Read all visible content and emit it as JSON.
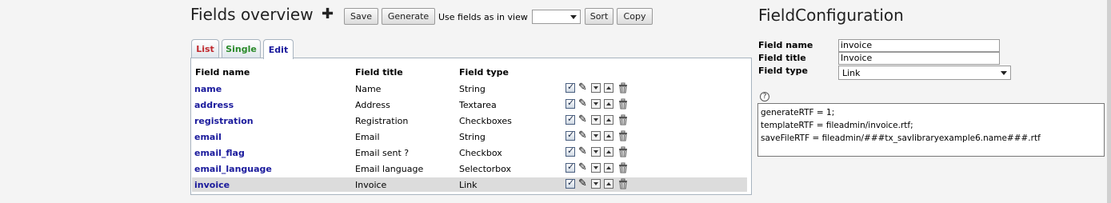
{
  "overview": {
    "title": "Fields overview",
    "add_icon": "plus-icon",
    "save_label": "Save",
    "generate_label": "Generate",
    "use_fields_label": "Use fields as in view",
    "view_select_value": "",
    "sort_label": "Sort",
    "copy_label": "Copy"
  },
  "tabs": [
    {
      "label": "List",
      "color": "#c0282d"
    },
    {
      "label": "Single",
      "color": "#2a8a2a"
    },
    {
      "label": "Edit",
      "color": "#1a1a9c"
    }
  ],
  "table": {
    "headers": [
      "Field name",
      "Field title",
      "Field type"
    ],
    "rows": [
      {
        "name": "name",
        "title": "Name",
        "type": "String"
      },
      {
        "name": "address",
        "title": "Address",
        "type": "Textarea"
      },
      {
        "name": "registration",
        "title": "Registration",
        "type": "Checkboxes"
      },
      {
        "name": "email",
        "title": "Email",
        "type": "String"
      },
      {
        "name": "email_flag",
        "title": "Email sent ?",
        "type": "Checkbox"
      },
      {
        "name": "email_language",
        "title": "Email language",
        "type": "Selectorbox"
      },
      {
        "name": "invoice",
        "title": "Invoice",
        "type": "Link",
        "selected": true
      }
    ],
    "row_icons": [
      "checkbox-icon",
      "pen-icon",
      "move-down-icon",
      "move-up-icon",
      "trash-icon"
    ]
  },
  "config": {
    "title": "FieldConfiguration",
    "field_name_label": "Field name",
    "field_name_value": "invoice",
    "field_title_label": "Field title",
    "field_title_value": "Invoice",
    "field_type_label": "Field type",
    "field_type_value": "Link",
    "help_icon": "help-icon",
    "config_lines": [
      "generateRTF = 1;",
      "templateRTF = fileadmin/invoice.rtf;",
      "saveFileRTF = fileadmin/###tx_savlibraryexample6.name###.rtf"
    ]
  }
}
